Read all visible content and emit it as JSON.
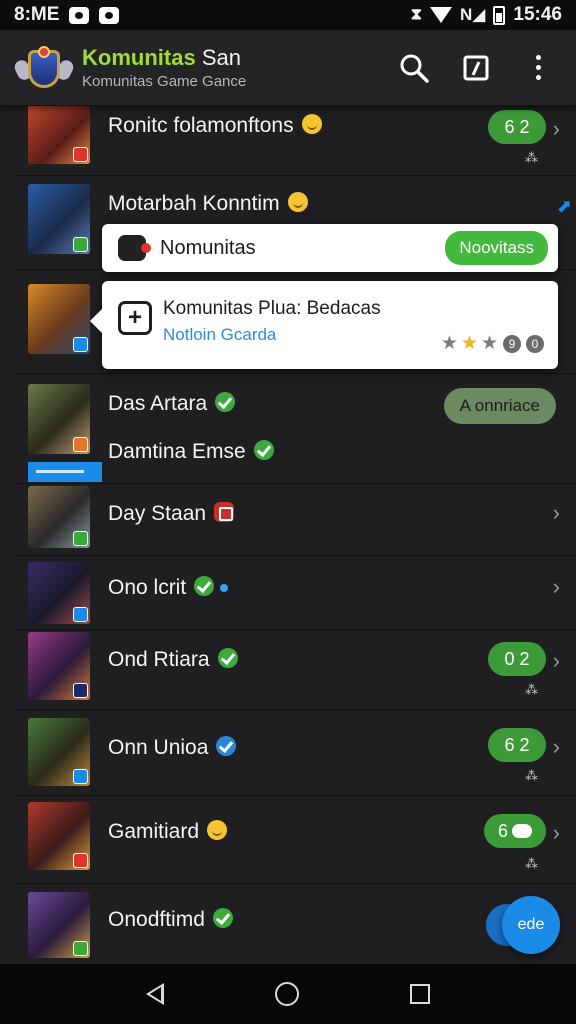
{
  "status_bar": {
    "left_text": "8:ME",
    "time": "15:46"
  },
  "app_bar": {
    "title_green": "Komunitas",
    "title_white": "San",
    "subtitle": "Komunitas Game Gance",
    "icons": [
      "search-icon",
      "edit-icon",
      "overflow-menu-icon"
    ]
  },
  "rows": [
    {
      "name": "Ronitc folamonftons",
      "pill": "6 2",
      "sub": "⁂"
    },
    {
      "name": "Motarbah Konntim"
    },
    {
      "name": ""
    },
    {
      "name": "Das Artara",
      "name2": "Damtina Emse",
      "button": "A onnriace"
    },
    {
      "name": "Day Staan"
    },
    {
      "name": "Ono lcrit"
    },
    {
      "name": "Ond Rtiara",
      "pill": "0 2",
      "sub": "⁂"
    },
    {
      "name": "Onn Unioa",
      "pill": "6 2",
      "sub": "⁂"
    },
    {
      "name": "Gamitiard",
      "pill": "6",
      "sub": "⁂"
    },
    {
      "name": "Onodftimd"
    }
  ],
  "popup_notification": {
    "text": "Nomunitas",
    "button": "Noovitass"
  },
  "popup_card": {
    "title": "Komunitas Plua: Bedacas",
    "subtitle": "Notloin Gcarda",
    "rating_text": "9",
    "count_text": "0"
  },
  "fab": {
    "label": "ede"
  },
  "colors": {
    "accent_green": "#3c9b38",
    "title_green": "#9fdc3a",
    "accent_blue": "#1b8be8",
    "background": "#1f1f21"
  }
}
